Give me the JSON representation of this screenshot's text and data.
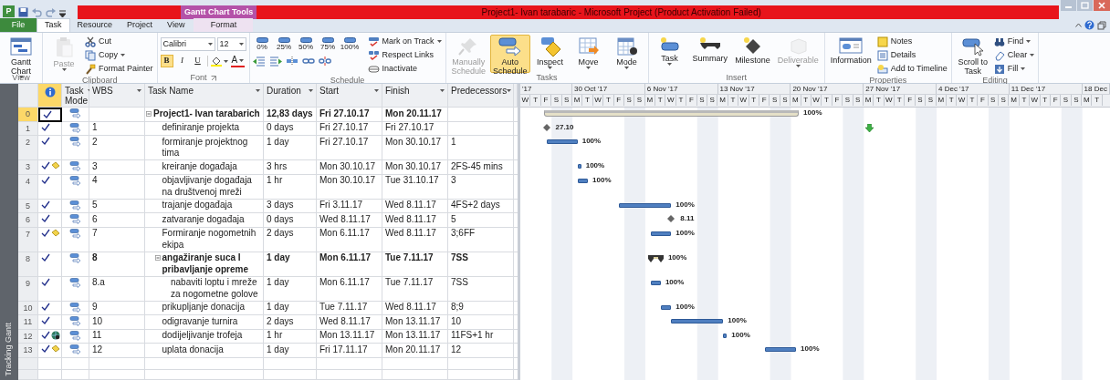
{
  "title_bar": {
    "app_logo": "P",
    "contextual_tab": "Gantt Chart Tools",
    "title": "Project1- Ivan tarabaric - Microsoft Project (Product Activation Failed)"
  },
  "ribbon_tabs": [
    {
      "label": "File",
      "kind": "file",
      "selected": false
    },
    {
      "label": "Task",
      "kind": "tab",
      "selected": true
    },
    {
      "label": "Resource",
      "kind": "tab",
      "selected": false
    },
    {
      "label": "Project",
      "kind": "tab",
      "selected": false
    },
    {
      "label": "View",
      "kind": "tab",
      "selected": false
    },
    {
      "label": "Format",
      "kind": "contextual",
      "selected": false
    }
  ],
  "ribbon_groups": [
    {
      "kind": "buttons",
      "label": "View",
      "items": [
        {
          "kind": "large",
          "label": "Gantt Chart",
          "dropdown": true,
          "disabled": false
        }
      ]
    },
    {
      "kind": "buttons",
      "label": "Clipboard",
      "items": [
        {
          "kind": "large",
          "label": "Paste",
          "dropdown": true,
          "disabled": true
        },
        {
          "kind": "small",
          "label": "Cut",
          "dropdown": false,
          "disabled": false
        },
        {
          "kind": "small",
          "label": "Copy",
          "dropdown": true,
          "disabled": false
        },
        {
          "kind": "small",
          "label": "Format Painter",
          "dropdown": false,
          "disabled": false
        }
      ]
    },
    {
      "kind": "font",
      "label": "Font",
      "font": "Calibri",
      "size": "12",
      "styles": [
        {
          "label": "B",
          "selected": true
        },
        {
          "label": "I",
          "selected": false
        },
        {
          "label": "U",
          "selected": false
        }
      ],
      "font_color": "A"
    },
    {
      "kind": "schedule",
      "label": "Schedule",
      "percent": [
        "0%",
        "25%",
        "50%",
        "75%",
        "100%"
      ],
      "items": [
        {
          "kind": "small",
          "label": "Mark on Track",
          "dropdown": true,
          "disabled": false
        },
        {
          "kind": "small",
          "label": "Respect Links",
          "dropdown": false,
          "disabled": false
        },
        {
          "kind": "small",
          "label": "Inactivate",
          "dropdown": false,
          "disabled": false
        }
      ]
    },
    {
      "kind": "buttons",
      "label": "Tasks",
      "items": [
        {
          "kind": "large",
          "label": "Manually Schedule",
          "dropdown": false,
          "disabled": true,
          "selected": false
        },
        {
          "kind": "large",
          "label": "Auto Schedule",
          "dropdown": false,
          "disabled": false,
          "selected": true
        },
        {
          "kind": "large",
          "label": "Inspect",
          "dropdown": true,
          "disabled": false,
          "selected": false
        },
        {
          "kind": "large",
          "label": "Move",
          "dropdown": true,
          "disabled": false,
          "selected": false
        },
        {
          "kind": "large",
          "label": "Mode",
          "dropdown": true,
          "disabled": false,
          "selected": false
        }
      ]
    },
    {
      "kind": "buttons",
      "label": "Insert",
      "items": [
        {
          "kind": "large",
          "label": "Task",
          "dropdown": true,
          "disabled": false
        },
        {
          "kind": "large",
          "label": "Summary",
          "dropdown": false,
          "disabled": false
        },
        {
          "kind": "large",
          "label": "Milestone",
          "dropdown": false,
          "disabled": false
        },
        {
          "kind": "large",
          "label": "Deliverable",
          "dropdown": true,
          "disabled": true
        }
      ]
    },
    {
      "kind": "buttons",
      "label": "Properties",
      "items": [
        {
          "kind": "large",
          "label": "Information",
          "dropdown": false,
          "disabled": false
        },
        {
          "kind": "small",
          "label": "Notes",
          "dropdown": false,
          "disabled": false
        },
        {
          "kind": "small",
          "label": "Details",
          "dropdown": false,
          "disabled": false
        },
        {
          "kind": "small",
          "label": "Add to Timeline",
          "dropdown": false,
          "disabled": false
        }
      ]
    },
    {
      "kind": "buttons",
      "label": "Editing",
      "items": [
        {
          "kind": "large",
          "label": "Scroll to Task",
          "dropdown": false,
          "disabled": false
        },
        {
          "kind": "small",
          "label": "Find",
          "dropdown": true,
          "disabled": false
        },
        {
          "kind": "small",
          "label": "Clear",
          "dropdown": true,
          "disabled": false
        },
        {
          "kind": "small",
          "label": "Fill",
          "dropdown": true,
          "disabled": false
        }
      ]
    }
  ],
  "view_bar": {
    "label": "Tracking Gantt"
  },
  "columns": [
    {
      "kind": "indicators"
    },
    {
      "kind": "text",
      "label": "Task Mode"
    },
    {
      "kind": "text",
      "label": "WBS"
    },
    {
      "kind": "text",
      "label": "Task Name"
    },
    {
      "kind": "text",
      "label": "Duration"
    },
    {
      "kind": "text",
      "label": "Start"
    },
    {
      "kind": "text",
      "label": "Finish"
    },
    {
      "kind": "text",
      "label": "Predecessors"
    }
  ],
  "timeline": {
    "weeks": [
      {
        "label": "'17",
        "days": [
          "W",
          "T",
          "F",
          "S",
          "S"
        ]
      },
      {
        "label": "30 Oct '17",
        "days": [
          "M",
          "T",
          "W",
          "T",
          "F",
          "S",
          "S"
        ]
      },
      {
        "label": "6 Nov '17",
        "days": [
          "M",
          "T",
          "W",
          "T",
          "F",
          "S",
          "S"
        ]
      },
      {
        "label": "13 Nov '17",
        "days": [
          "M",
          "T",
          "W",
          "T",
          "F",
          "S",
          "S"
        ]
      },
      {
        "label": "20 Nov '17",
        "days": [
          "M",
          "T",
          "W",
          "T",
          "F",
          "S",
          "S"
        ]
      },
      {
        "label": "27 Nov '17",
        "days": [
          "M",
          "T",
          "W",
          "T",
          "F",
          "S",
          "S"
        ]
      },
      {
        "label": "4 Dec '17",
        "days": [
          "M",
          "T",
          "W",
          "T",
          "F",
          "S",
          "S"
        ]
      },
      {
        "label": "11 Dec '17",
        "days": [
          "M",
          "T",
          "W",
          "T",
          "F",
          "S",
          "S"
        ]
      },
      {
        "label": "18 Dec",
        "days": [
          "M",
          "T"
        ]
      }
    ]
  },
  "tasks": [
    {
      "id": "0",
      "kind": "summary",
      "selected": true,
      "completed": true,
      "note": false,
      "hyperlink": false,
      "name": "Project1- Ivan tarabarich",
      "duration": "12,83 days",
      "start": "Fri 27.10.17",
      "finish": "Mon 20.11.17",
      "bar_label": "100%",
      "expanded": true,
      "children": [
        {
          "id": "1",
          "kind": "milestone",
          "selected": false,
          "completed": true,
          "note": false,
          "hyperlink": false,
          "wbs": "1",
          "name": "definiranje projekta",
          "duration": "0 days",
          "start": "Fri 27.10.17",
          "finish": "Fri 27.10.17",
          "bar_label": "27.10",
          "deadline": true
        },
        {
          "id": "2",
          "kind": "task",
          "selected": false,
          "completed": true,
          "note": false,
          "hyperlink": false,
          "wbs": "2",
          "name": "formiranje projektnog tima",
          "duration": "1 day",
          "start": "Fri 27.10.17",
          "finish": "Mon 30.10.17",
          "predecessors": "1",
          "bar_label": "100%"
        },
        {
          "id": "3",
          "kind": "task",
          "selected": false,
          "completed": true,
          "note": true,
          "hyperlink": false,
          "wbs": "3",
          "name": "kreiranje događaja",
          "duration": "3 hrs",
          "start": "Mon 30.10.17",
          "finish": "Mon 30.10.17",
          "predecessors": "2FS-45 mins",
          "bar_label": "100%"
        },
        {
          "id": "4",
          "kind": "task",
          "selected": false,
          "completed": true,
          "note": false,
          "hyperlink": false,
          "wbs": "4",
          "name": "objavljivanje događaja na društvenoj mreži",
          "duration": "1 hr",
          "start": "Mon 30.10.17",
          "finish": "Tue 31.10.17",
          "predecessors": "3",
          "bar_label": "100%"
        },
        {
          "id": "5",
          "kind": "task",
          "selected": false,
          "completed": true,
          "note": false,
          "hyperlink": false,
          "wbs": "5",
          "name": "trajanje događaja",
          "duration": "3 days",
          "start": "Fri 3.11.17",
          "finish": "Wed 8.11.17",
          "predecessors": "4FS+2 days",
          "bar_label": "100%"
        },
        {
          "id": "6",
          "kind": "milestone",
          "selected": false,
          "completed": true,
          "note": false,
          "hyperlink": false,
          "wbs": "6",
          "name": "zatvaranje događaja",
          "duration": "0 days",
          "start": "Wed 8.11.17",
          "finish": "Wed 8.11.17",
          "predecessors": "5",
          "bar_label": "8.11"
        },
        {
          "id": "7",
          "kind": "task",
          "selected": false,
          "completed": true,
          "note": true,
          "hyperlink": false,
          "wbs": "7",
          "name": "Formiranje nogometnih ekipa",
          "duration": "2 days",
          "start": "Mon 6.11.17",
          "finish": "Wed 8.11.17",
          "predecessors": "3;6FF",
          "bar_label": "100%"
        },
        {
          "id": "8",
          "kind": "summary",
          "selected": false,
          "completed": true,
          "note": false,
          "hyperlink": false,
          "wbs": "8",
          "name": "angažiranje suca I pribavljanje opreme",
          "duration": "1 day",
          "start": "Mon 6.11.17",
          "finish": "Tue 7.11.17",
          "predecessors": "7SS",
          "bar_label": "100%",
          "expanded": true,
          "children": [
            {
              "id": "9",
              "kind": "task",
              "selected": false,
              "completed": true,
              "note": false,
              "hyperlink": false,
              "wbs": "8.a",
              "name": "nabaviti loptu i mreže za nogometne golove",
              "duration": "1 day",
              "start": "Mon 6.11.17",
              "finish": "Tue 7.11.17",
              "predecessors": "7SS",
              "bar_label": "100%"
            }
          ]
        },
        {
          "id": "10",
          "kind": "task",
          "selected": false,
          "completed": true,
          "note": false,
          "hyperlink": false,
          "wbs": "9",
          "name": "prikupljanje donacija",
          "duration": "1 day",
          "start": "Tue 7.11.17",
          "finish": "Wed 8.11.17",
          "predecessors": "8;9",
          "bar_label": "100%"
        },
        {
          "id": "11",
          "kind": "task",
          "selected": false,
          "completed": true,
          "note": false,
          "hyperlink": false,
          "wbs": "10",
          "name": "odigravanje turnira",
          "duration": "2 days",
          "start": "Wed 8.11.17",
          "finish": "Mon 13.11.17",
          "predecessors": "10",
          "bar_label": "100%"
        },
        {
          "id": "12",
          "kind": "task",
          "selected": false,
          "completed": true,
          "note": false,
          "hyperlink": true,
          "wbs": "11",
          "name": "dodijeljivanje trofeja",
          "duration": "1 hr",
          "start": "Mon 13.11.17",
          "finish": "Mon 13.11.17",
          "predecessors": "11FS+1 hr",
          "bar_label": "100%"
        },
        {
          "id": "13",
          "kind": "task",
          "selected": false,
          "completed": true,
          "note": true,
          "hyperlink": false,
          "wbs": "12",
          "name": "uplata donacija",
          "duration": "1 day",
          "start": "Fri 17.11.17",
          "finish": "Mon 20.11.17",
          "predecessors": "12",
          "bar_label": "100%"
        }
      ]
    }
  ]
}
